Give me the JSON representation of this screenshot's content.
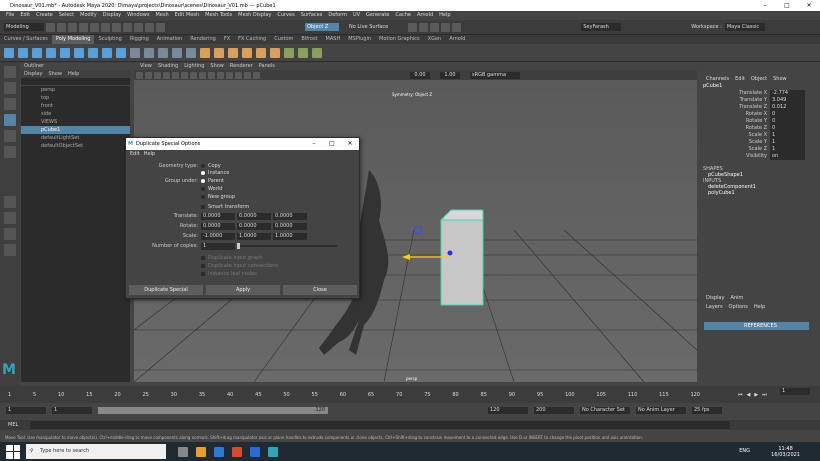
{
  "app": {
    "title": "Dinosaur_V01.mb* - Autodesk Maya 2020: D\\maya\\projects\\Dinosaur\\scenes\\Dinosaur_V01.mb  ---  pCube1",
    "workspace_label": "Workspace :",
    "workspace_value": "Maya Classic"
  },
  "menubar": [
    "File",
    "Edit",
    "Create",
    "Select",
    "Modify",
    "Display",
    "Windows",
    "Mesh",
    "Edit Mesh",
    "Mesh Tools",
    "Mesh Display",
    "Curves",
    "Surfaces",
    "Deform",
    "UV",
    "Generate",
    "Cache",
    "Arnold",
    "Help"
  ],
  "toolbar": {
    "mode": "Modeling",
    "object_field": "Object Z",
    "live_surface": "No Live Surface",
    "user": "SeyFarash"
  },
  "shelf_tabs": [
    "Curves / Surfaces",
    "Poly Modeling",
    "Sculpting",
    "Rigging",
    "Animation",
    "Rendering",
    "FX",
    "FX Caching",
    "Custom",
    "Bifrost",
    "MASH",
    "MSPlugin",
    "Motion Graphics",
    "XGen",
    "Arnold"
  ],
  "shelf_active": 1,
  "outliner": {
    "title": "Outliner",
    "menu": [
      "Display",
      "Show",
      "Help"
    ],
    "items": [
      {
        "label": "persp",
        "selected": false
      },
      {
        "label": "top",
        "selected": false
      },
      {
        "label": "front",
        "selected": false
      },
      {
        "label": "side",
        "selected": false
      },
      {
        "label": "VIEWS",
        "selected": false
      },
      {
        "label": "pCube1",
        "selected": true
      },
      {
        "label": "defaultLightSet",
        "selected": false
      },
      {
        "label": "defaultObjectSet",
        "selected": false
      }
    ]
  },
  "viewport": {
    "menu": [
      "View",
      "Shading",
      "Lighting",
      "Show",
      "Renderer",
      "Panels"
    ],
    "exposure": "0.00",
    "gamma": "1.00",
    "colorspace": "sRGB gamma",
    "symmetry_label": "Symmetry: Object Z",
    "camera_label": "persp"
  },
  "channel_box": {
    "menu": [
      "Channels",
      "Edit",
      "Object",
      "Show"
    ],
    "object_name": "pCube1",
    "attributes": [
      {
        "name": "Translate X",
        "value": "-2.774"
      },
      {
        "name": "Translate Y",
        "value": "3.049"
      },
      {
        "name": "Translate Z",
        "value": "0.012"
      },
      {
        "name": "Rotate X",
        "value": "0"
      },
      {
        "name": "Rotate Y",
        "value": "0"
      },
      {
        "name": "Rotate Z",
        "value": "0"
      },
      {
        "name": "Scale X",
        "value": "1"
      },
      {
        "name": "Scale Y",
        "value": "1"
      },
      {
        "name": "Scale Z",
        "value": "1"
      },
      {
        "name": "Visibility",
        "value": "on"
      }
    ],
    "shapes_label": "SHAPES",
    "shape_name": "pCubeShape1",
    "inputs_label": "INPUTS",
    "inputs": [
      "deleteComponent1",
      "polyCube1"
    ],
    "layer_tabs": [
      "Display",
      "Anim"
    ],
    "layer_menu": [
      "Layers",
      "Options",
      "Help"
    ],
    "layer_item": "REFERENCES"
  },
  "dialog": {
    "title": "Duplicate Special Options",
    "menu": [
      "Edit",
      "Help"
    ],
    "geometry_type_label": "Geometry type:",
    "geometry_options": [
      {
        "label": "Copy",
        "on": false
      },
      {
        "label": "Instance",
        "on": true
      }
    ],
    "group_under_label": "Group under:",
    "group_options": [
      {
        "label": "Parent",
        "on": true
      },
      {
        "label": "World",
        "on": false
      },
      {
        "label": "New group",
        "on": false
      }
    ],
    "smart_transform": "Smart transform",
    "translate_label": "Translate:",
    "translate": [
      "0.0000",
      "0.0000",
      "0.0000"
    ],
    "rotate_label": "Rotate:",
    "rotate": [
      "0.0000",
      "0.0000",
      "0.0000"
    ],
    "scale_label": "Scale:",
    "scale": [
      "-1.0000",
      "1.0000",
      "1.0000"
    ],
    "copies_label": "Number of copies:",
    "copies": "1",
    "disabled_options": [
      "Duplicate input graph",
      "Duplicate input connections",
      "Instance leaf nodes"
    ],
    "buttons": [
      "Duplicate Special",
      "Apply",
      "Close"
    ]
  },
  "timeline": {
    "ticks": [
      "1",
      "5",
      "10",
      "15",
      "20",
      "25",
      "30",
      "35",
      "40",
      "45",
      "50",
      "55",
      "60",
      "65",
      "70",
      "75",
      "80",
      "85",
      "90",
      "95",
      "100",
      "105",
      "110",
      "115",
      "120"
    ],
    "current_frame": "1",
    "range_start": "1",
    "range_start2": "1",
    "range_slider_end": "120",
    "range_end": "120",
    "range_max": "200",
    "character_set": "No Character Set",
    "anim_layer": "No Anim Layer",
    "fps": "25 fps"
  },
  "command_line": {
    "label": "MEL"
  },
  "help_line": "Move Tool: Use manipulator to move object(s). Ctrl+middle-drag to move components along normals. Shift+drag manipulator axis or plane handles to extrude components or clone objects. Ctrl+Shift+drag to constrain movement to a connected edge. Use D or INSERT to change the pivot position and axis orientation.",
  "taskbar": {
    "search_placeholder": "Type here to search",
    "time": "11:48",
    "date": "16/03/2021",
    "lang": "ENG"
  },
  "side_tabs": [
    "Channel Box / Layer Editor",
    "Modeling Toolkit",
    "Attribute Editor"
  ]
}
